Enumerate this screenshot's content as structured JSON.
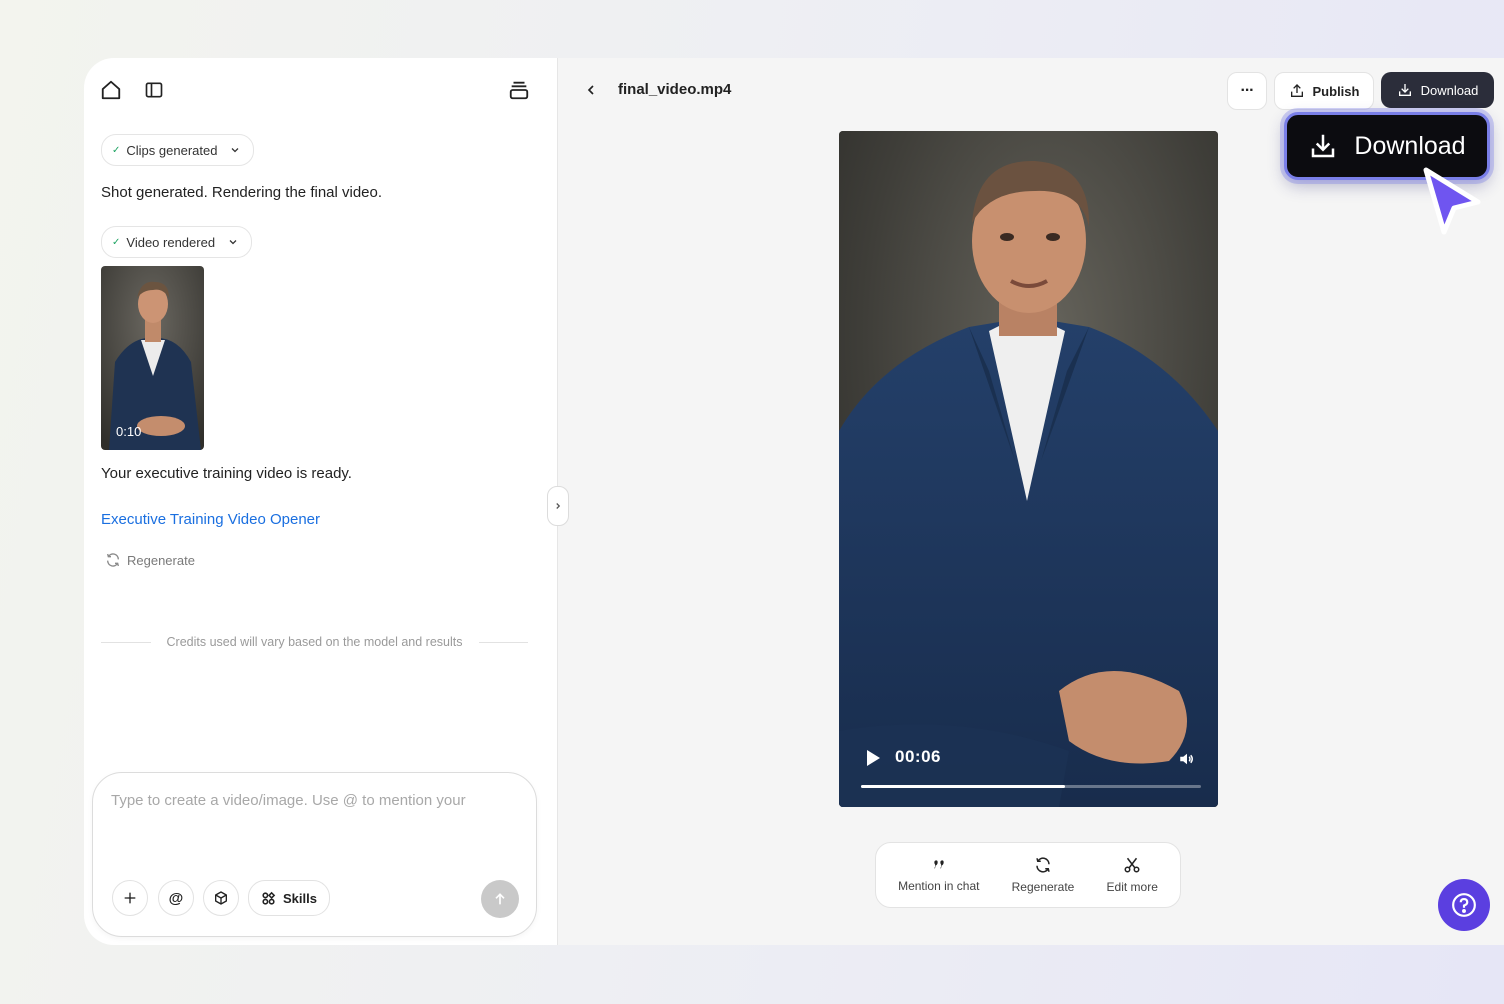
{
  "header": {
    "file_title": "final_video.mp4",
    "publish_label": "Publish",
    "download_label": "Download",
    "more_label": "···"
  },
  "chat": {
    "chip_clips": "Clips generated",
    "message_shot": "Shot generated. Rendering the final video.",
    "chip_video": "Video rendered",
    "thumb_duration": "0:10",
    "message_ready": "Your executive training video is ready.",
    "link_text": "Executive Training Video Opener",
    "regenerate_label": "Regenerate",
    "credits_note": "Credits used will vary based on the model and results"
  },
  "composer": {
    "placeholder": "Type to create a video/image. Use @ to mention your",
    "plus_label": "+",
    "mention_label": "@",
    "skills_label": "Skills"
  },
  "player": {
    "current_time": "00:06",
    "progress_percent": 60
  },
  "actions": {
    "mention_label": "Mention in chat",
    "regenerate_label": "Regenerate",
    "edit_label": "Edit more"
  },
  "callout": {
    "download_label": "Download"
  },
  "colors": {
    "accent": "#5b3fe0",
    "link": "#1a6fe0",
    "download_bg": "#2b2d3a"
  }
}
